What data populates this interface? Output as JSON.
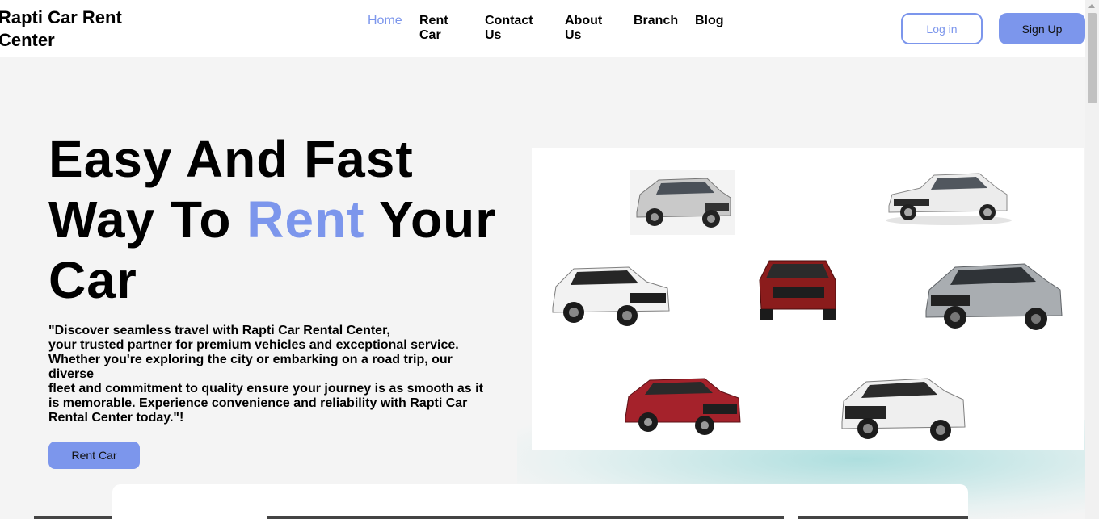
{
  "header": {
    "brand": "Rapti Car Rent Center",
    "nav": [
      "Home",
      "Rent Car",
      "Contact Us",
      "About Us",
      "Branch",
      "Blog"
    ],
    "login_label": "Log in",
    "signup_label": "Sign Up"
  },
  "hero": {
    "title_line1": "Easy And Fast",
    "title_line2_start": "Way To ",
    "title_accent": "Rent",
    "title_line2_end": " Your",
    "title_line3": "Car",
    "description_lines": [
      "\"Discover seamless travel with Rapti Car Rental Center,",
      "your trusted partner for premium vehicles and exceptional service.",
      "Whether you're exploring the city or embarking on a road trip, our diverse",
      "fleet and commitment to quality ensure your journey is as smooth as it is memorable. Experience convenience and reliability with Rapti Car Rental Center today.\"!"
    ],
    "button_label": "Rent Car"
  },
  "colors": {
    "accent": "#7c96ec",
    "background": "#f4f4f4"
  },
  "cars": [
    {
      "name": "silver-suv-car",
      "color": "#c9c9c9"
    },
    {
      "name": "white-sedan-car",
      "color": "#e6e6e6"
    },
    {
      "name": "white-rav4-car",
      "color": "#efefef"
    },
    {
      "name": "red-suv-car",
      "color": "#8b1c1c"
    },
    {
      "name": "gray-crossover-car",
      "color": "#a9adb1"
    },
    {
      "name": "red-crossover-car",
      "color": "#a5222b"
    },
    {
      "name": "white-xtrail-car",
      "color": "#eeeeee"
    }
  ]
}
